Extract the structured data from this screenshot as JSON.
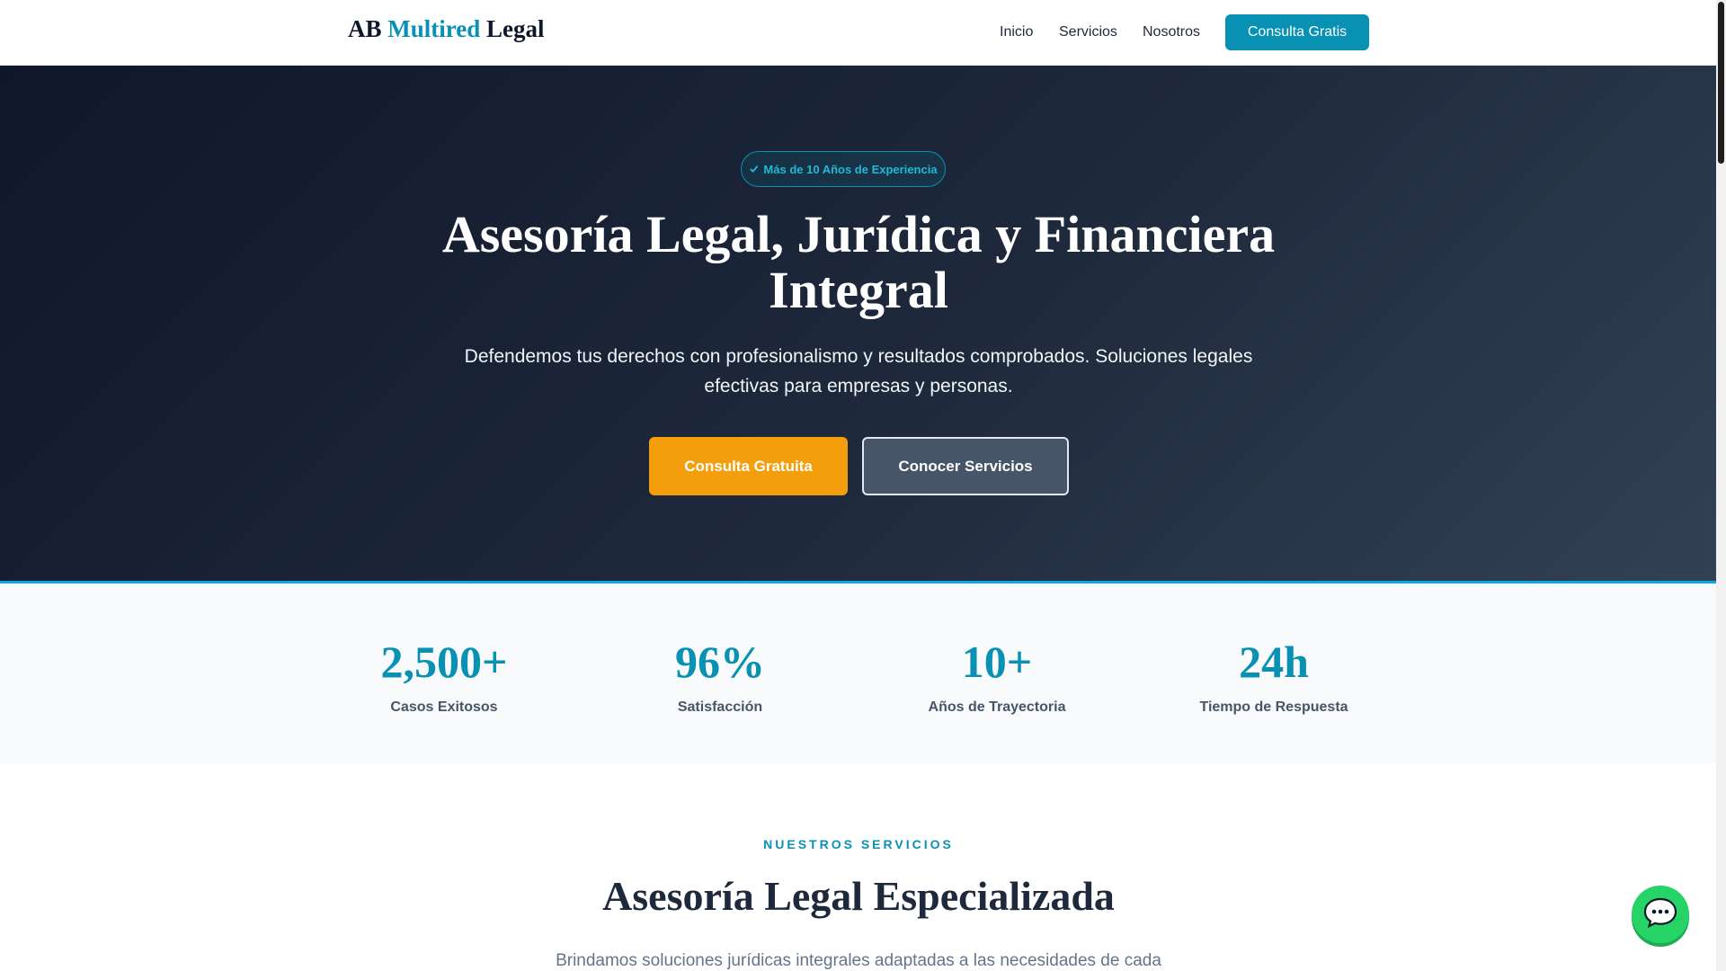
{
  "header": {
    "logo": {
      "part1": "AB",
      "part2": "Multired",
      "part3": "Legal"
    },
    "nav": [
      "Inicio",
      "Servicios",
      "Nosotros"
    ],
    "cta": "Consulta Gratis"
  },
  "hero": {
    "badge_icon": "check-icon",
    "badge": "Más de 10 Años de Experiencia",
    "title": "Asesoría Legal, Jurídica y Financiera Integral",
    "subtitle": "Defendemos tus derechos con profesionalismo y resultados comprobados. Soluciones legales efectivas para empresas y personas.",
    "primary_button": "Consulta Gratuita",
    "secondary_button": "Conocer Servicios"
  },
  "stats": [
    {
      "value": "2,500+",
      "label": "Casos Exitosos"
    },
    {
      "value": "96%",
      "label": "Satisfacción"
    },
    {
      "value": "10+",
      "label": "Años de Trayectoria"
    },
    {
      "value": "24h",
      "label": "Tiempo de Respuesta"
    }
  ],
  "services": {
    "eyebrow": "NUESTROS SERVICIOS",
    "title": "Asesoría Legal Especializada",
    "subtitle": "Brindamos soluciones jurídicas integrales adaptadas a las necesidades de cada"
  },
  "chat": {
    "icon": "chat-bubble-icon"
  },
  "colors": {
    "accent": "#0891b2",
    "primary_button": "#f59e0b",
    "hero_bg": "#0f172a",
    "chat": "#25d366"
  }
}
